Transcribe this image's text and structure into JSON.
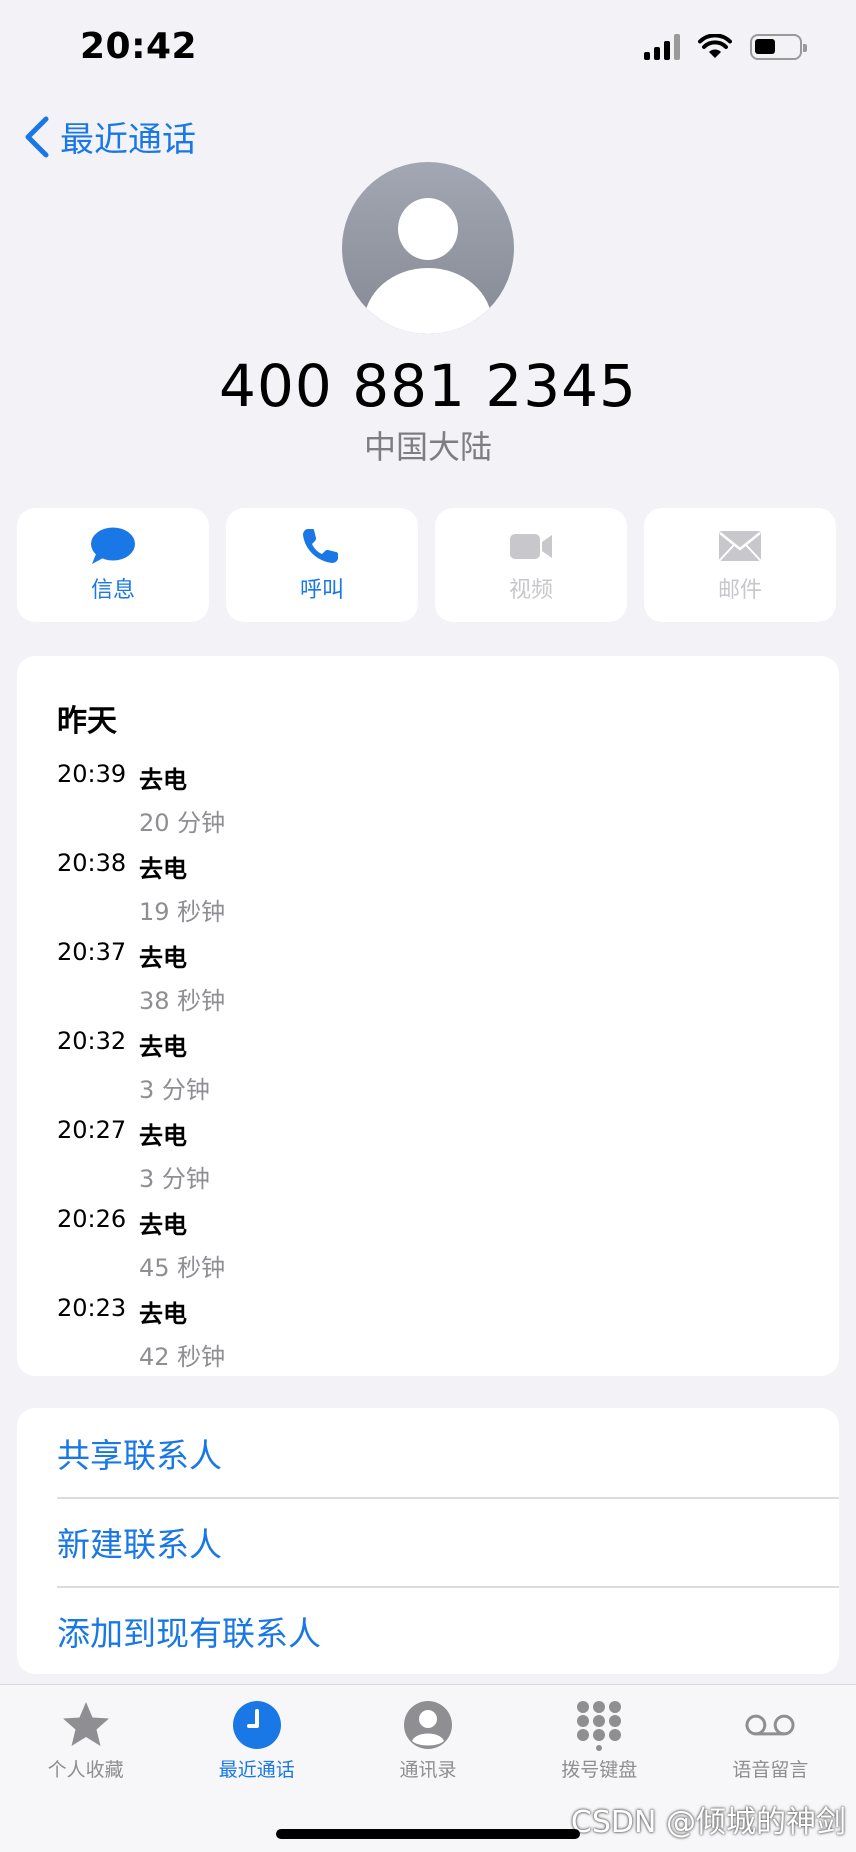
{
  "status_bar": {
    "time": "20:42"
  },
  "nav": {
    "back_label": "最近通话"
  },
  "contact": {
    "number": "400 881 2345",
    "region": "中国大陆"
  },
  "actions": [
    {
      "label": "信息",
      "icon": "message-icon",
      "enabled": true
    },
    {
      "label": "呼叫",
      "icon": "phone-icon",
      "enabled": true
    },
    {
      "label": "视频",
      "icon": "video-icon",
      "enabled": false
    },
    {
      "label": "邮件",
      "icon": "mail-icon",
      "enabled": false
    }
  ],
  "history": {
    "title": "昨天",
    "calls": [
      {
        "time": "20:39",
        "type": "去电",
        "duration": "20 分钟"
      },
      {
        "time": "20:38",
        "type": "去电",
        "duration": "19 秒钟"
      },
      {
        "time": "20:37",
        "type": "去电",
        "duration": "38 秒钟"
      },
      {
        "time": "20:32",
        "type": "去电",
        "duration": "3 分钟"
      },
      {
        "time": "20:27",
        "type": "去电",
        "duration": "3 分钟"
      },
      {
        "time": "20:26",
        "type": "去电",
        "duration": "45 秒钟"
      },
      {
        "time": "20:23",
        "type": "去电",
        "duration": "42 秒钟"
      }
    ]
  },
  "options": {
    "share": "共享联系人",
    "new": "新建联系人",
    "add_existing": "添加到现有联系人"
  },
  "tabs": [
    {
      "label": "个人收藏",
      "icon": "star-icon",
      "active": false
    },
    {
      "label": "最近通话",
      "icon": "clock-icon",
      "active": true
    },
    {
      "label": "通讯录",
      "icon": "contacts-icon",
      "active": false
    },
    {
      "label": "拨号键盘",
      "icon": "keypad-icon",
      "active": false
    },
    {
      "label": "语音留言",
      "icon": "voicemail-icon",
      "active": false
    }
  ],
  "watermark": "CSDN @倾城的神剑",
  "colors": {
    "accent": "#1a78e6",
    "disabled": "#c7c7cc",
    "background": "#f2f2f7"
  }
}
